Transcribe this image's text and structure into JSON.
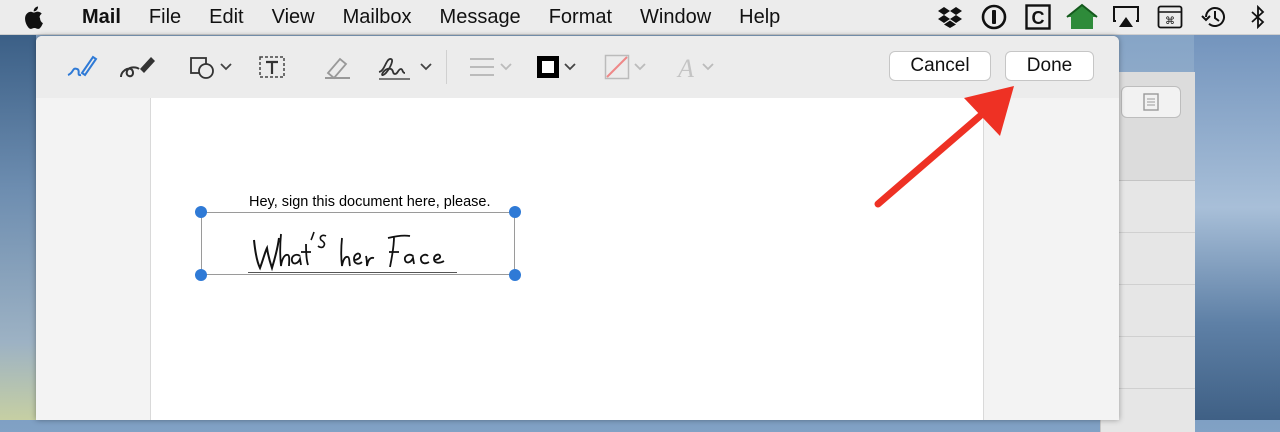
{
  "menubar": {
    "app_name": "Mail",
    "items": [
      "File",
      "Edit",
      "View",
      "Mailbox",
      "Message",
      "Format",
      "Window",
      "Help"
    ],
    "status_icons": [
      "dropbox-icon",
      "1password-icon",
      "c-icon",
      "house-icon",
      "airplay-icon",
      "keyboard-icon",
      "time-machine-icon",
      "bluetooth-icon"
    ]
  },
  "toolbar": {
    "tools": [
      "sketch-tool",
      "draw-tool",
      "shapes-tool",
      "text-tool",
      "highlight-tool",
      "sign-tool",
      "line-style-tool",
      "border-color-tool",
      "fill-color-tool",
      "text-style-tool"
    ],
    "cancel_label": "Cancel",
    "done_label": "Done"
  },
  "document": {
    "instruction_text": "Hey, sign this document here, please.",
    "signature_text": "What's her Face"
  },
  "colors": {
    "accent": "#2f7ad6",
    "annotation_arrow": "#ee3124"
  }
}
